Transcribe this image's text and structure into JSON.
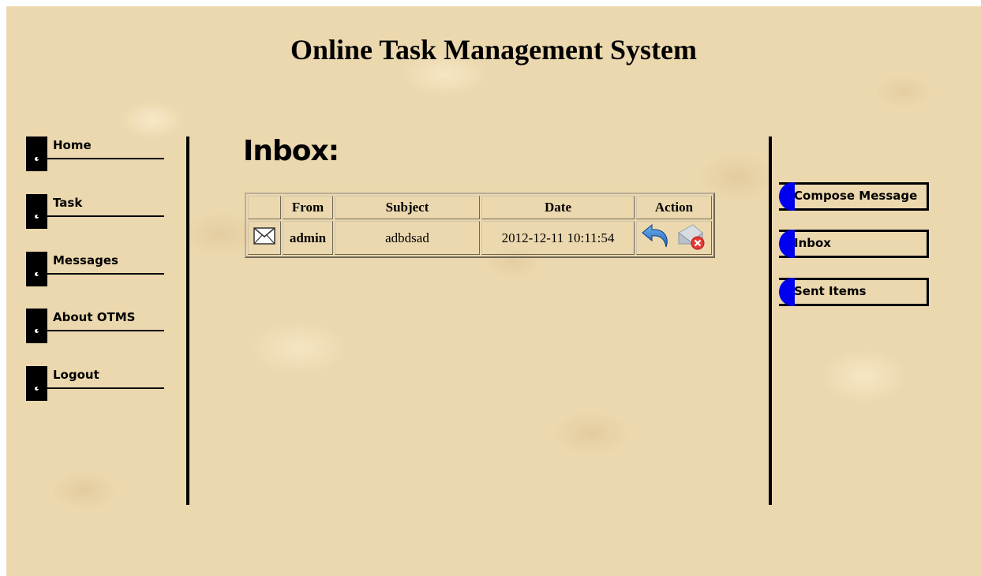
{
  "header": {
    "title": "Online Task Management System"
  },
  "sidebar": {
    "items": [
      {
        "label": "Home"
      },
      {
        "label": "Task"
      },
      {
        "label": "Messages"
      },
      {
        "label": "About OTMS"
      },
      {
        "label": "Logout"
      }
    ]
  },
  "main": {
    "heading": "Inbox:",
    "table": {
      "columns": [
        "",
        "From",
        "Subject",
        "Date",
        "Action"
      ],
      "rows": [
        {
          "icon": "envelope-icon",
          "from": "admin",
          "subject": "adbdsad",
          "date": "2012-12-11 10:11:54",
          "actions": [
            "reply-icon",
            "delete-mail-icon"
          ]
        }
      ]
    }
  },
  "right_nav": {
    "items": [
      {
        "label": "Compose Message"
      },
      {
        "label": "Inbox"
      },
      {
        "label": "Sent Items"
      }
    ],
    "accent": "#0000ee"
  },
  "colors": {
    "background": "#ecd8ae",
    "text": "#000000"
  }
}
